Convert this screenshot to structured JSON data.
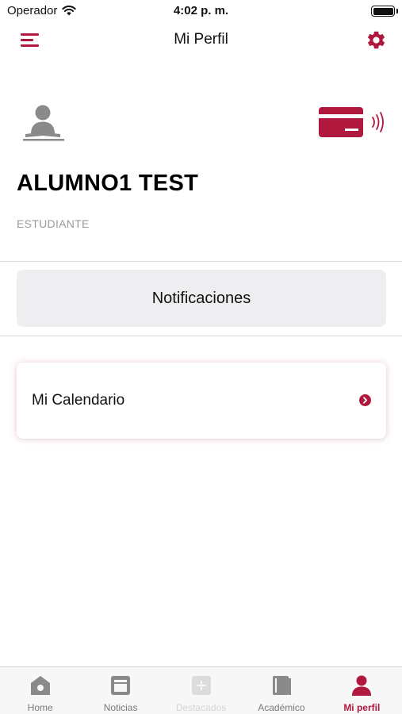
{
  "status_bar": {
    "carrier": "Operador",
    "time": "4:02 p. m."
  },
  "nav": {
    "title": "Mi Perfil"
  },
  "profile": {
    "name": "ALUMNO1 TEST",
    "role": "ESTUDIANTE"
  },
  "notifications_button": {
    "label": "Notificaciones"
  },
  "calendar": {
    "label": "Mi Calendario"
  },
  "tabs": [
    {
      "label": "Home",
      "icon": "home-icon",
      "state": "normal"
    },
    {
      "label": "Noticias",
      "icon": "news-icon",
      "state": "normal"
    },
    {
      "label": "Destacados",
      "icon": "featured-icon",
      "state": "disabled"
    },
    {
      "label": "Académico",
      "icon": "book-icon",
      "state": "normal"
    },
    {
      "label": "Mi perfil",
      "icon": "profile-icon",
      "state": "active"
    }
  ],
  "colors": {
    "accent": "#b0183d",
    "icon_gray": "#8a8a8a",
    "button_bg": "#eeeef1"
  }
}
